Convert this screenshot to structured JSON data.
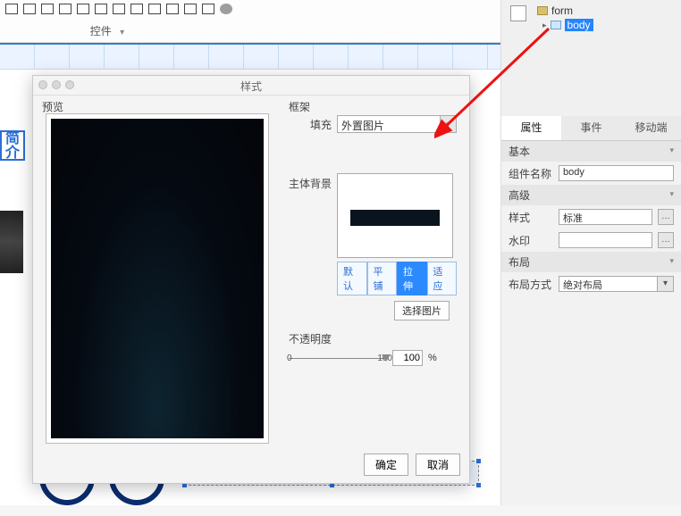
{
  "toolbar": {
    "label": "控件"
  },
  "outline": {
    "root": "form",
    "child": "body"
  },
  "canvas": {
    "side_title": "简介"
  },
  "modal": {
    "title": "样式",
    "preview_label": "预览",
    "frame_label": "框架",
    "fill_label": "填充",
    "fill_value": "外置图片",
    "body_bg_label": "主体背景",
    "btn_default": "默认",
    "btn_tile": "平铺",
    "btn_stretch": "拉伸",
    "btn_fit": "适应",
    "choose_image": "选择图片",
    "opacity_label": "不透明度",
    "slider_min": "0",
    "slider_max": "100",
    "opacity_value": "100",
    "pct": "%",
    "ok": "确定",
    "cancel": "取消"
  },
  "props": {
    "tabs": {
      "attr": "属性",
      "event": "事件",
      "mobile": "移动端"
    },
    "section_basic": "基本",
    "component_name_label": "组件名称",
    "component_name_value": "body",
    "section_advanced": "高级",
    "style_label": "样式",
    "style_value": "标准",
    "watermark_label": "水印",
    "watermark_value": "",
    "section_layout": "布局",
    "layout_mode_label": "布局方式",
    "layout_mode_value": "绝对布局"
  }
}
